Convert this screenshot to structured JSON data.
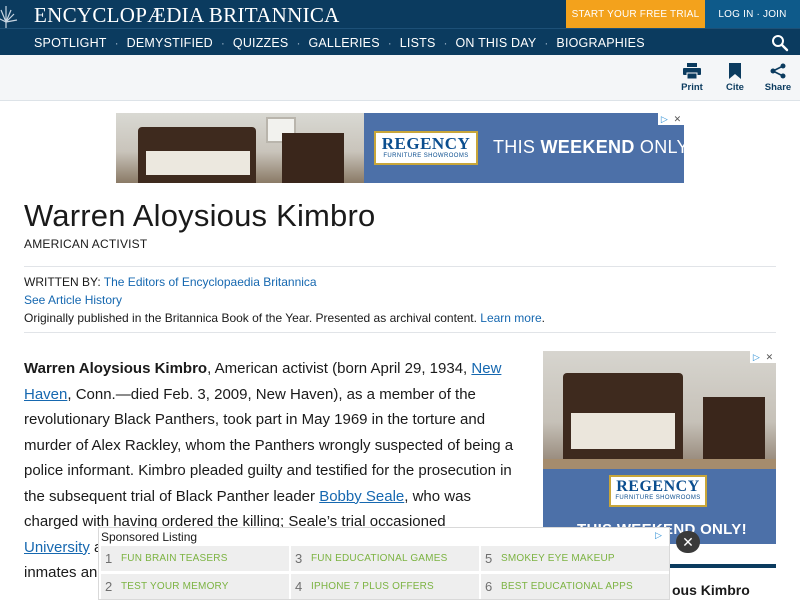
{
  "header": {
    "logo_text": "ENCYCLOPÆDIA BRITANNICA",
    "trial_label": "START YOUR FREE TRIAL",
    "login_label": "LOG IN · JOIN",
    "nav": [
      "SPOTLIGHT",
      "DEMYSTIFIED",
      "QUIZZES",
      "GALLERIES",
      "LISTS",
      "ON THIS DAY",
      "BIOGRAPHIES"
    ],
    "nav_separator": "·"
  },
  "toolbar": {
    "print": "Print",
    "cite": "Cite",
    "share": "Share"
  },
  "ads": {
    "banner": {
      "brand": "REGENCY",
      "brand_sub": "FURNITURE SHOWROOMS",
      "tagline_pre": "THIS ",
      "tagline_bold": "WEEKEND",
      "tagline_post": " ONLY!"
    },
    "side": {
      "brand": "REGENCY",
      "brand_sub": "FURNITURE SHOWROOMS",
      "tagline": "THIS WEEKEND ONLY!"
    },
    "adchoice_mark": "▷",
    "adchoice_x": "✕"
  },
  "article": {
    "title": "Warren Aloysious Kimbro",
    "subtitle": "AMERICAN ACTIVIST",
    "written_by_label": "WRITTEN BY: ",
    "written_by": "The Editors of Encyclopaedia Britannica",
    "history_link": "See Article History",
    "archival_note": "Originally published in the Britannica Book of the Year. Presented as archival content. ",
    "learn_more": "Learn more",
    "learn_more_period": ".",
    "body": {
      "name_bold": "Warren Aloysious Kimbro",
      "t1": ", American activist (born April 29, 1934, ",
      "link1": "New Haven",
      "t2": ", Conn.—died Feb. 3, 2009, New Haven), as a member of the revolutionary Black Panthers, took part in May 1969 in the torture and murder of Alex Rackley, whom the Panthers wrongly suspected of being a police informant. Kimbro pleaded guilty and testified for the prosecution in the subsequent trial of Black Panther leader ",
      "link2": "Bobby Seale",
      "t3": ", who was charged with having ordered the killing; Seale’s trial occasioned",
      "link3": "University",
      "t4": " a",
      "t5": "inmates an"
    }
  },
  "sidebar": {
    "card_text": "ous Kimbro"
  },
  "sponsored": {
    "heading": "Sponsored Listing",
    "items": [
      {
        "num": "1",
        "label": "FUN BRAIN TEASERS"
      },
      {
        "num": "3",
        "label": "FUN EDUCATIONAL GAMES"
      },
      {
        "num": "5",
        "label": "SMOKEY EYE MAKEUP"
      },
      {
        "num": "2",
        "label": "TEST YOUR MEMORY"
      },
      {
        "num": "4",
        "label": "IPHONE 7 PLUS OFFERS"
      },
      {
        "num": "6",
        "label": "BEST EDUCATIONAL APPS"
      }
    ],
    "close": "✕"
  },
  "colors": {
    "header_bg": "#0b3b5f",
    "trial_bg": "#f3a21c",
    "login_bg": "#0e5a8a",
    "link": "#1668b0",
    "ad_blue": "#4c70a8",
    "sponsor_label": "#7cb342"
  }
}
